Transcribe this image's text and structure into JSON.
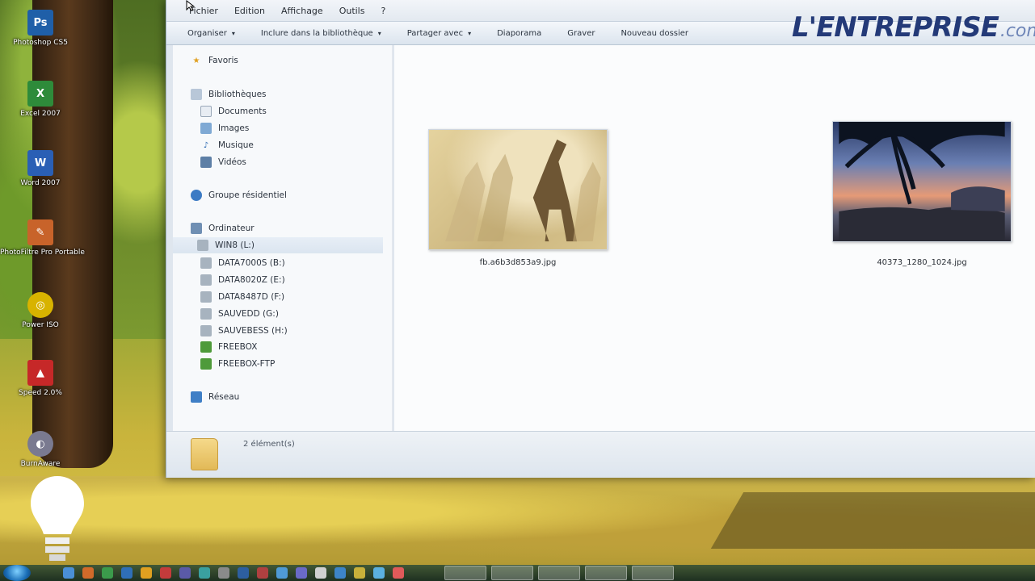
{
  "desktop": {
    "icons": [
      {
        "label": "Photoshop CS5",
        "glyph": "Ps",
        "color": "#1f5fa8"
      },
      {
        "label": "Excel 2007",
        "glyph": "X",
        "color": "#2e8b3a"
      },
      {
        "label": "Word 2007",
        "glyph": "W",
        "color": "#2a5fb5"
      },
      {
        "label": "PhotoFiltre Pro Portable",
        "glyph": "✎",
        "color": "#c8632a"
      },
      {
        "label": "Power ISO",
        "glyph": "◎",
        "color": "#d8b300"
      },
      {
        "label": "Speed 2.0%",
        "glyph": "▲",
        "color": "#c62828"
      },
      {
        "label": "BurnAware",
        "glyph": "◐",
        "color": "#7a7a90"
      }
    ]
  },
  "window": {
    "menu": [
      "Fichier",
      "Edition",
      "Affichage",
      "Outils",
      "?"
    ],
    "toolbar": [
      {
        "label": "Organiser",
        "caret": "▾"
      },
      {
        "label": "Inclure dans la bibliothèque",
        "caret": "▾"
      },
      {
        "label": "Partager avec",
        "caret": "▾"
      },
      {
        "label": "Diaporama",
        "caret": ""
      },
      {
        "label": "Graver",
        "caret": ""
      },
      {
        "label": "Nouveau dossier",
        "caret": ""
      }
    ],
    "nav": {
      "favoris": "Favoris",
      "bibliotheques": "Bibliothèques",
      "documents": "Documents",
      "images": "Images",
      "musique": "Musique",
      "videos": "Vidéos",
      "groupe": "Groupe résidentiel",
      "ordinateur": "Ordinateur",
      "drives": [
        "WIN8 (L:)",
        "DATA7000S (B:)",
        "DATA8020Z (E:)",
        "DATA8487D (F:)",
        "SAUVEDD (G:)",
        "SAUVEBESS (H:)",
        "FREEBOX",
        "FREEBOX-FTP"
      ],
      "reseau": "Réseau"
    },
    "files": [
      {
        "name": "fb.a6b3d853a9.jpg",
        "kind": "giraffe"
      },
      {
        "name": "40373_1280_1024.jpg",
        "kind": "beach"
      }
    ],
    "status": "2 élément(s)"
  },
  "watermark": {
    "brand": "L'ENTREPRISE",
    "suffix": ".com"
  }
}
